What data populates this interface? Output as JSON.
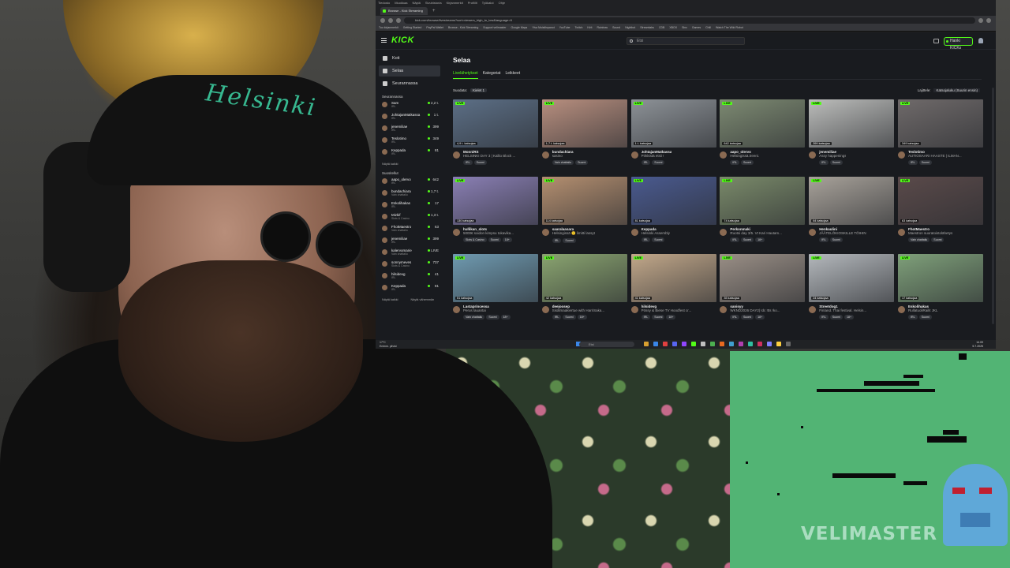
{
  "overlay": {
    "game_logo": "VELIMASTER"
  },
  "webcam": {
    "cap_text": "Helsinki"
  },
  "browser": {
    "menu": [
      "Tiedosto",
      "Muokkaa",
      "Näytä",
      "Sivuhistoria",
      "Kirjanmerkit",
      "Profiilit",
      "Työkalut",
      "Ohje"
    ],
    "tab_title": "Browse - Kick Streaming",
    "url": "kick.com/browse/livestreams?sort=viewers_high_to_low&language=fi",
    "bookmarks": [
      "Tuo kirjanmerkit",
      "Getting Started",
      "PayPal Wallet",
      "Browse - Kick Streaming",
      "Support velimaster",
      "Google Maps",
      "Ylva Muistiinpanot",
      "YouTube",
      "Twitch",
      "Kirit",
      "Rainbow",
      "Sound",
      "Nightbot",
      "Streamlabs",
      "CDB",
      "XBOX",
      "Sinc",
      "Games",
      "Chill",
      "Watch The Wild Robot"
    ]
  },
  "site": {
    "logo": "KICK",
    "search_placeholder": "Etsi",
    "kicks_button": "Hanki KICKs",
    "page_title": "Selaa",
    "nav": [
      {
        "label": "Koti"
      },
      {
        "label": "Selaa"
      },
      {
        "label": "Seurannassa"
      }
    ],
    "following_title": "Seurannassa",
    "following": [
      {
        "name": "Sam",
        "category": "IRL",
        "viewers": "2,2 t."
      },
      {
        "name": "JohtajanMatkassa",
        "category": "IRL",
        "viewers": "1 t."
      },
      {
        "name": "jenemiliae",
        "category": "IRL",
        "viewers": "399"
      },
      {
        "name": "Teslotimo",
        "category": "IRL",
        "viewers": "349"
      },
      {
        "name": "Keppada",
        "category": "IRL",
        "viewers": "81"
      }
    ],
    "following_show_all": "Näytä kaikki",
    "recommended_title": "Suositellut",
    "recommended": [
      {
        "name": "aapo_olervo",
        "category": "IRL",
        "viewers": "642"
      },
      {
        "name": "bundachiara",
        "category": "Vain chattailu",
        "viewers": "1,7 t."
      },
      {
        "name": "Eskolihakas",
        "category": "IRL",
        "viewers": "17"
      },
      {
        "name": "Mizkif",
        "category": "Slots & Casino",
        "viewers": "1,3 t."
      },
      {
        "name": "FhotMaestro",
        "category": "Vain chattailu",
        "viewers": "63"
      },
      {
        "name": "jenemiliae",
        "category": "IRL",
        "viewers": "399"
      },
      {
        "name": "kalervomarie",
        "category": "Vain chattailu",
        "viewers": "LIVE"
      },
      {
        "name": "sonnymeves",
        "category": "Slots & Casino",
        "viewers": "737"
      },
      {
        "name": "hilsidevg",
        "category": "IRL",
        "viewers": "41"
      },
      {
        "name": "Keppada",
        "category": "IRL",
        "viewers": "81"
      }
    ],
    "recommended_show_all": "Näytä kaikki",
    "recommended_show_less": "Näytä vähemmän",
    "tabs": [
      "Livelähetykset",
      "Kategoriat",
      "Leikkeet"
    ],
    "filter_label": "Suodata:",
    "filter_value": "Kielet",
    "filter_count": "1",
    "sort_label": "Lajittele:",
    "sort_value": "Katsojaluku (Suurin ensin)",
    "live_badge": "LIVE",
    "streams": [
      {
        "viewers": "4,9 t. katsojaa",
        "name": "MonniRS",
        "title": "HELSINKI DAY 3 | Kallio Block ...",
        "tags": [
          "IRL",
          "Suomi"
        ],
        "color": "#5c6f86"
      },
      {
        "viewers": "1,7 t. katsojaa",
        "name": "bundachiara",
        "title": "sasino",
        "tags": [
          "Vain chattailu",
          "Suomi"
        ],
        "color": "#b88f7f"
      },
      {
        "viewers": "1 t. katsojaa",
        "name": "JohtajanMatkassa",
        "title": "Pirkkistä etsii !",
        "tags": [
          "IRL",
          "Suomi"
        ],
        "color": "#8d9297"
      },
      {
        "viewers": "642 katsojaa",
        "name": "aapo_olervo",
        "title": "Helsingissä.treeni.",
        "tags": [
          "IRL",
          "Suomi"
        ],
        "color": "#7d8a72"
      },
      {
        "viewers": "399 katsojaa",
        "name": "jenemiliae",
        "title": "Assy happenings",
        "tags": [
          "IRL",
          "Suomi"
        ],
        "color": "#bcbdbb"
      },
      {
        "viewers": "349 katsojaa",
        "name": "Teslotimo",
        "title": "AUTIOSAARI HAASTE | ILMAN...",
        "tags": [
          "IRL",
          "Suomi"
        ],
        "color": "#6f6a6a"
      },
      {
        "viewers": "130 katsojaa",
        "name": "hullikan_slots",
        "title": "5000€ soidon kimpsu tokavika...",
        "tags": [
          "Slots & Casino",
          "Suomi",
          "18+"
        ],
        "color": "#8a7fb4"
      },
      {
        "viewers": "114 katsojaa",
        "name": "saaralaasara",
        "title": "Helsingissä 🙂 limitti lassyt",
        "tags": [
          "IRL",
          "Suomi"
        ],
        "color": "#b48f70"
      },
      {
        "viewers": "81 katsojaa",
        "name": "Keppada",
        "title": "Helsinki Assembly",
        "tags": [
          "IRL",
          "Suomi"
        ],
        "color": "#4a5a8f"
      },
      {
        "viewers": "74 katsojaa",
        "name": "Perkonmaki",
        "title": "Ruotsi day 3/5. Vt Kari Hautam...",
        "tags": [
          "IRL",
          "Suomi",
          "18+"
        ],
        "color": "#7a8a6a"
      },
      {
        "viewers": "64 katsojaa",
        "name": "Henkaulini",
        "title": "JÄÄTELÖKIOSKILLE TÖIHIN",
        "tags": [
          "IRL",
          "Suomi"
        ],
        "color": "#a8a29a"
      },
      {
        "viewers": "63 katsojaa",
        "name": "FhotMaestro",
        "title": "Maestron suoratoistolähetys",
        "tags": [
          "Vain chattailu",
          "Suomi"
        ],
        "color": "#5a4a4a"
      },
      {
        "viewers": "51 katsojaa",
        "name": "Lastaprincessa",
        "title": "Perus lauantai",
        "tags": [
          "Vain chattailu",
          "Suomi",
          "18+"
        ],
        "color": "#6f9ab0"
      },
      {
        "viewers": "42 katsojaa",
        "name": "deejoosep",
        "title": "Sisälmaakiertue with HarriSaka...",
        "tags": [
          "IRL",
          "Suomi",
          "18+"
        ],
        "color": "#8aa470"
      },
      {
        "viewers": "41 katsojaa",
        "name": "hilsidevg",
        "title": "Pössy & Biese TV Hoodfest cr...",
        "tags": [
          "IRL",
          "Suomi",
          "18+"
        ],
        "color": "#c2a88a"
      },
      {
        "viewers": "35 katsojaa",
        "name": "sanisyy",
        "title": "WKND2026 DAY2| !dc !tts !ko...",
        "tags": [
          "IRL",
          "Suomi",
          "18+"
        ],
        "color": "#9a8f86"
      },
      {
        "viewers": "24 katsojaa",
        "name": "Streetdog1",
        "title": "Finland. Thai festival. Helsin...",
        "tags": [
          "IRL",
          "Suomi",
          "18+"
        ],
        "color": "#b4b8bc"
      },
      {
        "viewers": "17 katsojaa",
        "name": "Eskolihakas",
        "title": "RullatuoliRailit JKL",
        "tags": [
          "IRL",
          "Suomi"
        ],
        "color": "#7fa07a"
      }
    ]
  },
  "taskbar": {
    "weather_temp": "17°C",
    "weather_desc": "Enimm. pilvist",
    "search": "Etsi",
    "time": "14.09",
    "date": "5.7.2025"
  }
}
